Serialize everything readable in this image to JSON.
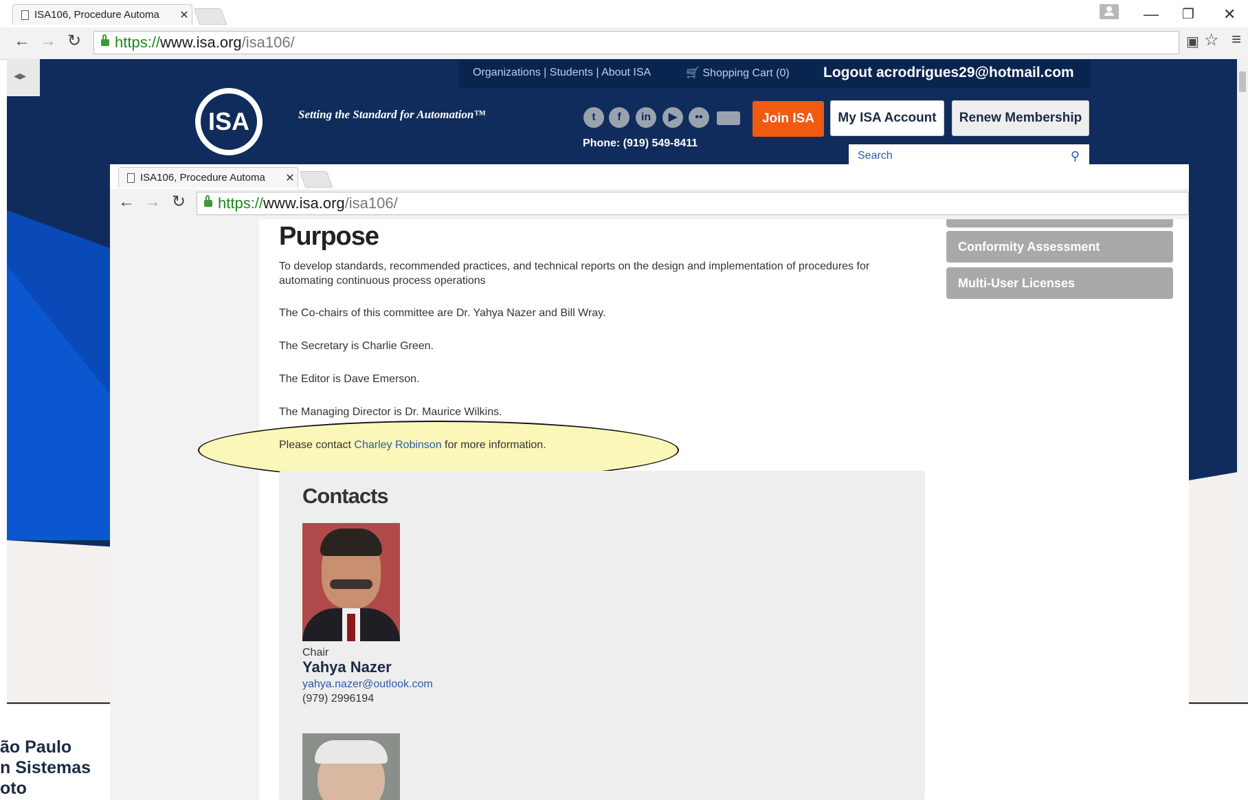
{
  "back_browser": {
    "tab_title": "ISA106, Procedure Automa",
    "url_https": "https://",
    "url_host": "www.isa.org",
    "url_path": "/isa106/"
  },
  "isa_header": {
    "top_links": [
      "Organizations",
      "|",
      "Students",
      "|",
      "About ISA"
    ],
    "cart": "Shopping Cart (0)",
    "logout": "Logout acrodrigues29@hotmail.com",
    "logo_text": "ISA",
    "tagline": "Setting the Standard for Automation™",
    "phone": "Phone: (919) 549-8411",
    "join": "Join ISA",
    "my_account": "My ISA Account",
    "renew": "Renew Membership",
    "search_placeholder": "Search",
    "colors": {
      "navy": "#0f2c5c",
      "orange": "#f05a12",
      "blue": "#0a49b8"
    }
  },
  "front_browser": {
    "tab_title": "ISA106, Procedure Automa",
    "url_https": "https://",
    "url_host": "www.isa.org",
    "url_path": "/isa106/"
  },
  "page": {
    "purpose_title": "Purpose",
    "purpose_text": "To develop standards, recommended practices, and technical reports on the design and implementation of procedures for automating continuous process operations",
    "cochairs": "The Co-chairs of this committee are Dr. Yahya Nazer and Bill Wray.",
    "secretary": "The Secretary is Charlie Green.",
    "editor": "The Editor is Dave Emerson.",
    "director": "The Managing Director is Dr. Maurice Wilkins.",
    "contact_pre": "Please contact ",
    "contact_link": "Charley Robinson",
    "contact_post": " for more information.",
    "sidebar": [
      "Conformity Assessment",
      "Multi-User Licenses"
    ],
    "contacts_title": "Contacts",
    "contact1": {
      "role": "Chair",
      "name": "Yahya Nazer",
      "email": "yahya.nazer@outlook.com",
      "phone": "(979) 2996194"
    }
  },
  "slide_text": [
    "ão Paulo",
    "n Sistemas",
    "oto"
  ]
}
